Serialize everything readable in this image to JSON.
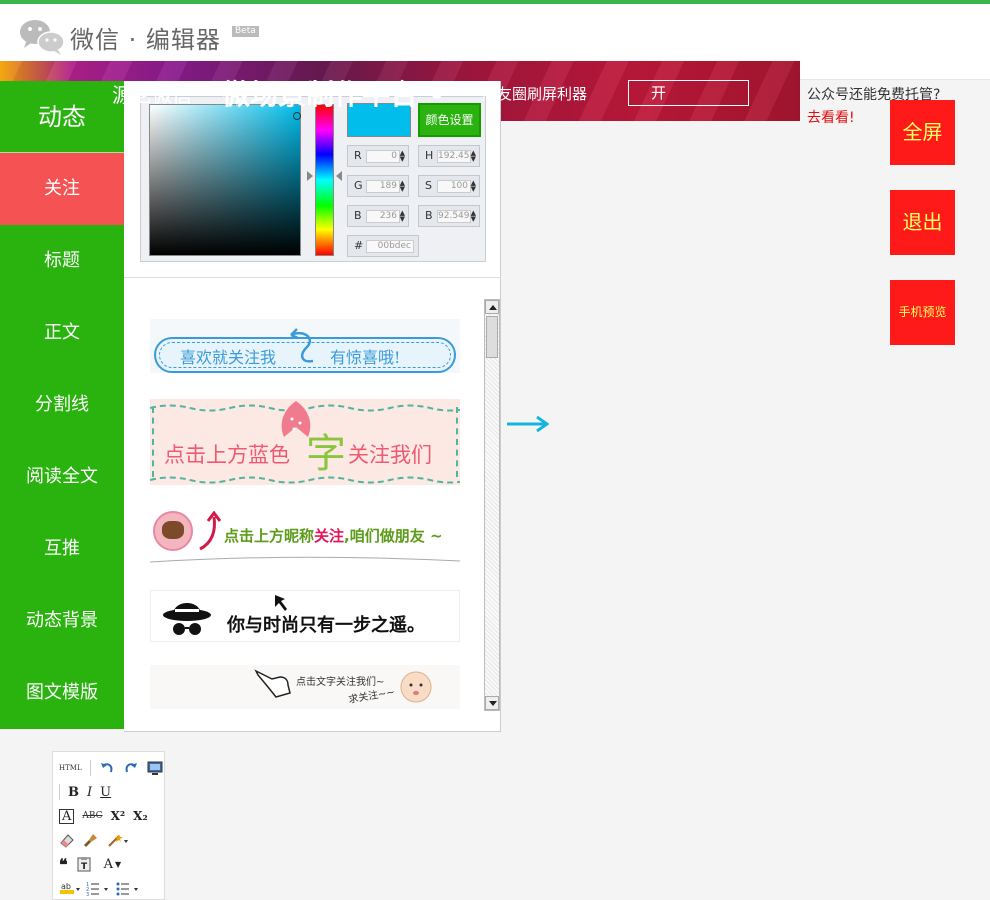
{
  "header": {
    "logo_text": "微信 · 编辑器",
    "beta": "Beta"
  },
  "banner": {
    "text1": "源尼微信",
    "text2": "微场景制作平台 •",
    "text3": "朋友圈刷屏利器",
    "button": "开"
  },
  "promo": {
    "line1": "公众号还能免费托管?",
    "line2": "去看看!"
  },
  "sidebar": {
    "items": [
      {
        "label": "动态"
      },
      {
        "label": "关注"
      },
      {
        "label": "标题"
      },
      {
        "label": "正文"
      },
      {
        "label": "分割线"
      },
      {
        "label": "阅读全文"
      },
      {
        "label": "互推"
      },
      {
        "label": "动态背景"
      },
      {
        "label": "图文模版"
      }
    ]
  },
  "color_picker": {
    "button": "颜色设置",
    "preview_color": "#00bdec",
    "r_label": "R",
    "r_value": "0",
    "g_label": "G",
    "g_value": "189",
    "b_label": "B",
    "b_value": "236",
    "h_label": "H",
    "h_value": "192.45",
    "s_label": "S",
    "s_value": "100",
    "b2_label": "B",
    "b2_value": "92.5490",
    "hex_label": "#",
    "hex_value": "00bdec"
  },
  "templates": {
    "t1_left": "喜欢就关注我",
    "t1_right": "有惊喜哦!",
    "t2_left": "点击上方蓝色",
    "t2_mid": "字",
    "t2_right": "关注我们",
    "t3_text": "点击上方昵称",
    "t3_em": "关注",
    "t3_tail": ",咱们做朋友 ~",
    "t4_text": "你与时尚只有一步之遥。",
    "t5_line1": "点击文字关注我们~",
    "t5_line2": "求关注~~"
  },
  "right_buttons": {
    "fullscreen": "全屏",
    "exit": "退出",
    "phone_preview": "手机预览"
  },
  "toolbar": {
    "html": "HTML",
    "bold": "B",
    "italic": "I",
    "underline": "U",
    "font_color": "A",
    "strike": "ABC",
    "sup": "X²",
    "sub": "X₂",
    "font_size": "A"
  },
  "colors": {
    "green": "#2ab20f",
    "active_red": "#f55353",
    "button_red": "#ff1a1a",
    "accent_blue": "#00bdec"
  }
}
